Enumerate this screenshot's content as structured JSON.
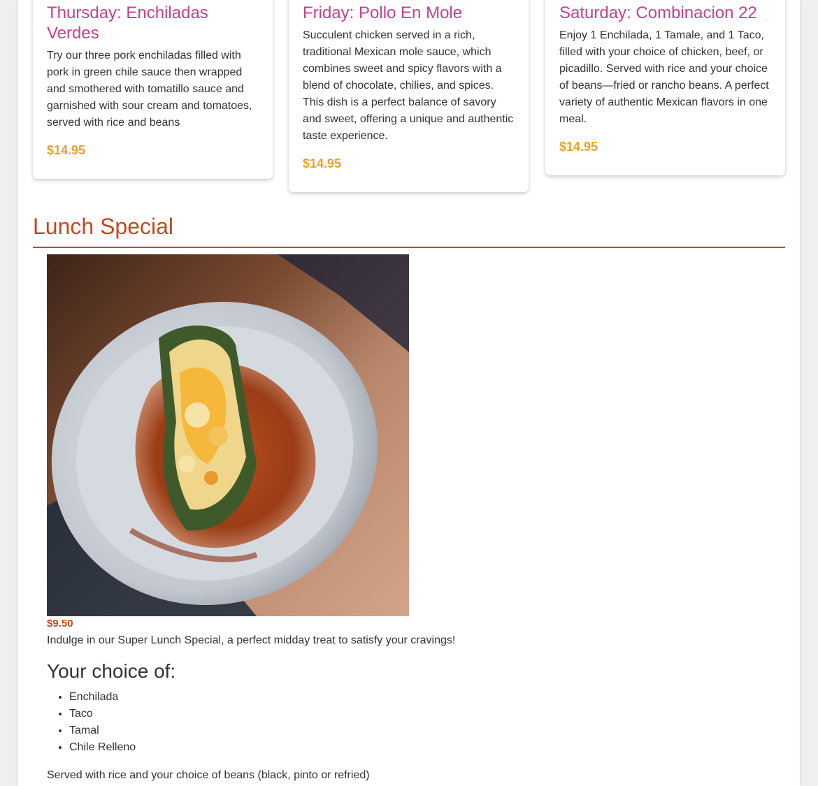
{
  "colors": {
    "card_title": "#cc3d8f",
    "price": "#e8a22f",
    "section_accent": "#c8471d",
    "text": "#333333"
  },
  "specials": [
    {
      "title": "Thursday: Enchiladas Verdes",
      "description": "Try our three pork enchiladas filled with pork in green chile sauce then wrapped and smothered with tomatillo sauce and garnished with sour cream and tomatoes, served with rice and beans",
      "price": "$14.95"
    },
    {
      "title": "Friday: Pollo En Mole",
      "description": "Succulent chicken served in a rich, traditional Mexican mole sauce, which combines sweet and spicy flavors with a blend of chocolate, chilies, and spices. This dish is a perfect balance of savory and sweet, offering a unique and authentic taste experience.",
      "price": "$14.95"
    },
    {
      "title": "Saturday: Combinacion 22",
      "description": "Enjoy 1 Enchilada, 1 Tamale, and 1 Taco, filled with your choice of chicken, beef, or picadillo. Served with rice and your choice of beans—fried or rancho beans. A perfect variety of authentic Mexican flavors in one meal.",
      "price": "$14.95"
    }
  ],
  "lunch": {
    "section_title": "Lunch Special",
    "price": "$9.50",
    "description": "Indulge in our Super Lunch Special, a perfect midday treat to satisfy your cravings!",
    "choice_heading": "Your choice of:",
    "choices": [
      "Enchilada",
      "Taco",
      "Tamal",
      "Chile Relleno"
    ],
    "served_note": "Served with rice and your choice of beans (black, pinto or refried)"
  }
}
